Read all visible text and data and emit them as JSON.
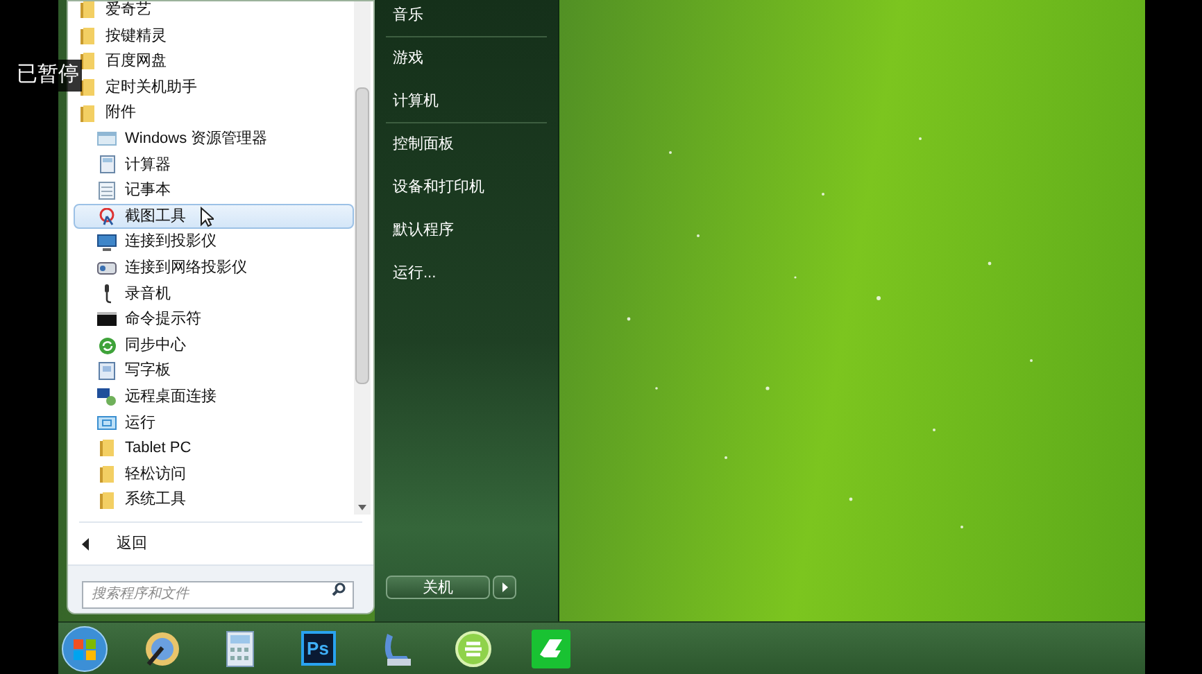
{
  "player_status": "已暂停",
  "programs": [
    {
      "label": "爱奇艺",
      "kind": "folder",
      "selected": false
    },
    {
      "label": "按键精灵",
      "kind": "folder",
      "selected": false
    },
    {
      "label": "百度网盘",
      "kind": "folder",
      "selected": false
    },
    {
      "label": "定时关机助手",
      "kind": "folder",
      "selected": false
    },
    {
      "label": "附件",
      "kind": "folder",
      "selected": false,
      "children": [
        {
          "label": "Windows 资源管理器",
          "kind": "explorer",
          "selected": false
        },
        {
          "label": "计算器",
          "kind": "calculator",
          "selected": false
        },
        {
          "label": "记事本",
          "kind": "notepad",
          "selected": false
        },
        {
          "label": "截图工具",
          "kind": "snipping",
          "selected": true
        },
        {
          "label": "连接到投影仪",
          "kind": "monitor",
          "selected": false
        },
        {
          "label": "连接到网络投影仪",
          "kind": "projector",
          "selected": false
        },
        {
          "label": "录音机",
          "kind": "microphone",
          "selected": false
        },
        {
          "label": "命令提示符",
          "kind": "console",
          "selected": false
        },
        {
          "label": "同步中心",
          "kind": "sync",
          "selected": false
        },
        {
          "label": "写字板",
          "kind": "wordpad",
          "selected": false
        },
        {
          "label": "远程桌面连接",
          "kind": "remote",
          "selected": false
        },
        {
          "label": "运行",
          "kind": "run",
          "selected": false
        },
        {
          "label": "Tablet PC",
          "kind": "folder",
          "selected": false
        },
        {
          "label": "轻松访问",
          "kind": "folder",
          "selected": false
        },
        {
          "label": "系统工具",
          "kind": "folder",
          "selected": false
        }
      ]
    }
  ],
  "back": "返回",
  "search": {
    "placeholder": "搜索程序和文件"
  },
  "right_items": [
    {
      "label": "音乐",
      "separator_after": true
    },
    {
      "label": "游戏",
      "separator_after": false
    },
    {
      "label": "计算机",
      "separator_after": true
    },
    {
      "label": "控制面板",
      "separator_after": false
    },
    {
      "label": "设备和打印机",
      "separator_after": false
    },
    {
      "label": "默认程序",
      "separator_after": false
    },
    {
      "label": "运行...",
      "separator_after": false
    }
  ],
  "shutdown": "关机",
  "taskbar": [
    {
      "kind": "start"
    },
    {
      "kind": "media"
    },
    {
      "kind": "calculator"
    },
    {
      "kind": "photoshop",
      "label": "Ps"
    },
    {
      "kind": "scanner"
    },
    {
      "kind": "browser"
    },
    {
      "kind": "green-app"
    }
  ]
}
